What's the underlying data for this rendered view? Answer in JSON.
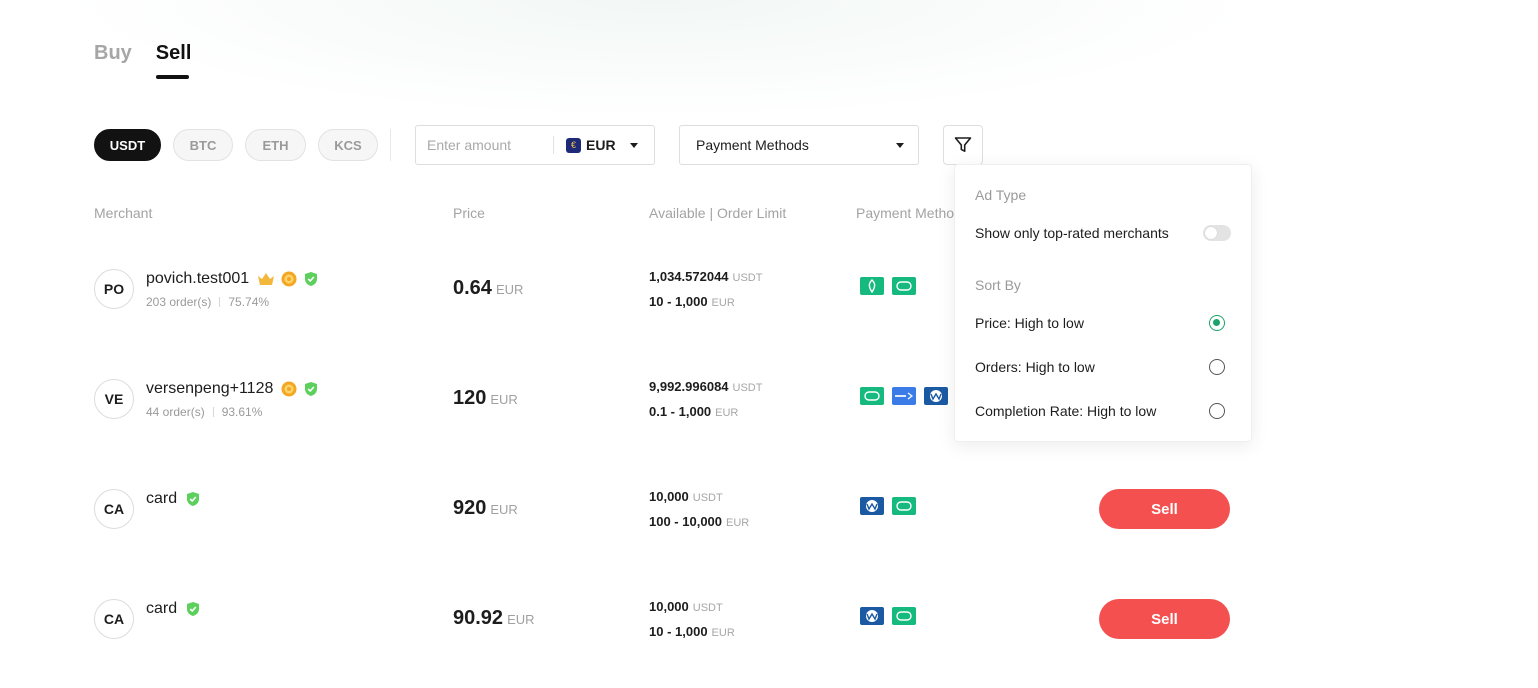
{
  "tabs": [
    {
      "label": "Buy",
      "active": false
    },
    {
      "label": "Sell",
      "active": true
    }
  ],
  "coins": [
    {
      "label": "USDT",
      "active": true
    },
    {
      "label": "BTC",
      "active": false
    },
    {
      "label": "ETH",
      "active": false
    },
    {
      "label": "KCS",
      "active": false
    }
  ],
  "amount": {
    "placeholder": "Enter amount",
    "currency": "EUR",
    "currency_icon": "euro-flag-icon"
  },
  "payment_methods": {
    "label": "Payment Methods"
  },
  "table": {
    "headers": {
      "merchant": "Merchant",
      "price": "Price",
      "available": "Available | Order Limit",
      "payment": "Payment Metho"
    },
    "rows": [
      {
        "avatar": "PO",
        "name": "povich.test001",
        "badges": [
          "crown-icon",
          "gold-medal-icon",
          "shield-icon"
        ],
        "orders": "203 order(s)",
        "completion": "75.74%",
        "price": "0.64",
        "price_unit": "EUR",
        "available": "1,034.572044",
        "available_unit": "USDT",
        "limit": "10 - 1,000",
        "limit_unit": "EUR",
        "payments": [
          "leaf-pay-icon",
          "cash-pay-icon"
        ],
        "action": ""
      },
      {
        "avatar": "VE",
        "name": "versenpeng+1128",
        "badges": [
          "gold-medal-icon",
          "shield-icon"
        ],
        "orders": "44 order(s)",
        "completion": "93.61%",
        "price": "120",
        "price_unit": "EUR",
        "available": "9,992.996084",
        "available_unit": "USDT",
        "limit": "0.1 - 1,000",
        "limit_unit": "EUR",
        "payments": [
          "cash-pay-icon",
          "alipay-icon",
          "webmoney-icon"
        ],
        "action": ""
      },
      {
        "avatar": "CA",
        "name": "card",
        "badges": [
          "shield-icon"
        ],
        "orders": "",
        "completion": "",
        "price": "920",
        "price_unit": "EUR",
        "available": "10,000",
        "available_unit": "USDT",
        "limit": "100 - 10,000",
        "limit_unit": "EUR",
        "payments": [
          "webmoney-icon",
          "cash-pay-icon"
        ],
        "action": "Sell"
      },
      {
        "avatar": "CA",
        "name": "card",
        "badges": [
          "shield-icon"
        ],
        "orders": "",
        "completion": "",
        "price": "90.92",
        "price_unit": "EUR",
        "available": "10,000",
        "available_unit": "USDT",
        "limit": "10 - 1,000",
        "limit_unit": "EUR",
        "payments": [
          "webmoney-icon",
          "cash-pay-icon"
        ],
        "action": "Sell"
      }
    ]
  },
  "filter_panel": {
    "ad_type_label": "Ad Type",
    "top_rated_label": "Show only top-rated merchants",
    "top_rated_on": false,
    "sort_label": "Sort By",
    "sort_options": [
      {
        "label": "Price: High to low",
        "selected": true
      },
      {
        "label": "Orders: High to low",
        "selected": false
      },
      {
        "label": "Completion Rate: High to low",
        "selected": false
      }
    ]
  },
  "colors": {
    "accent": "#1aa36a",
    "sell": "#f55050",
    "pay_green": "#16b97e",
    "pay_blue": "#1b5aa3",
    "alipay": "#3b7be8"
  }
}
